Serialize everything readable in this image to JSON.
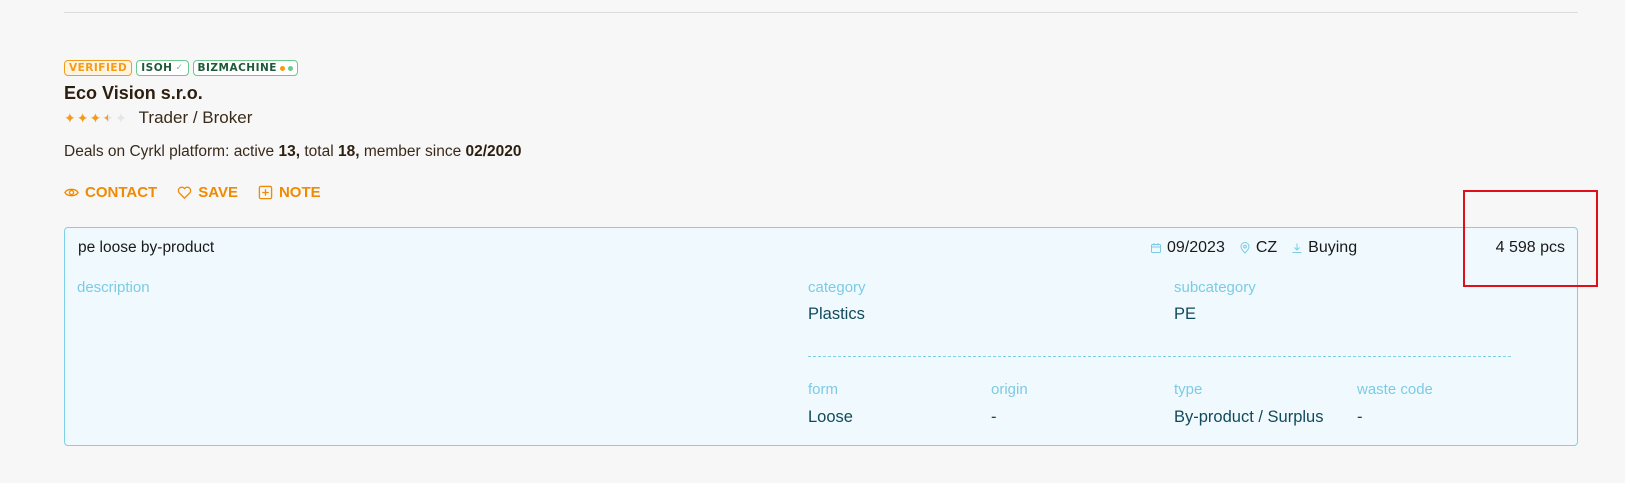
{
  "badges": {
    "verified": "VERIFIED",
    "isoh": "ISOH",
    "bizmachine": "BIZMACHINE"
  },
  "company": {
    "name": "Eco Vision s.r.o.",
    "rating": 3.5,
    "rating_max": 5,
    "role": "Trader / Broker"
  },
  "deals": {
    "prefix": "Deals on Cyrkl platform: active ",
    "active": "13,",
    "total_label": " total ",
    "total": "18,",
    "since_label": " member since ",
    "since": "02/2020"
  },
  "actions": {
    "contact": "CONTACT",
    "save": "SAVE",
    "note": "NOTE"
  },
  "listing": {
    "title": "pe loose by-product",
    "date": "09/2023",
    "country": "CZ",
    "direction": "Buying",
    "quantity": "4 598 pcs",
    "description_label": "description",
    "category_label": "category",
    "category": "Plastics",
    "subcategory_label": "subcategory",
    "subcategory": "PE",
    "form_label": "form",
    "form": "Loose",
    "origin_label": "origin",
    "origin": "-",
    "type_label": "type",
    "type": "By-product / Surplus",
    "waste_code_label": "waste code",
    "waste_code": "-"
  },
  "colors": {
    "accent": "#f08a00",
    "highlight": "#e0101a",
    "card_border": "#7fd0ea"
  }
}
